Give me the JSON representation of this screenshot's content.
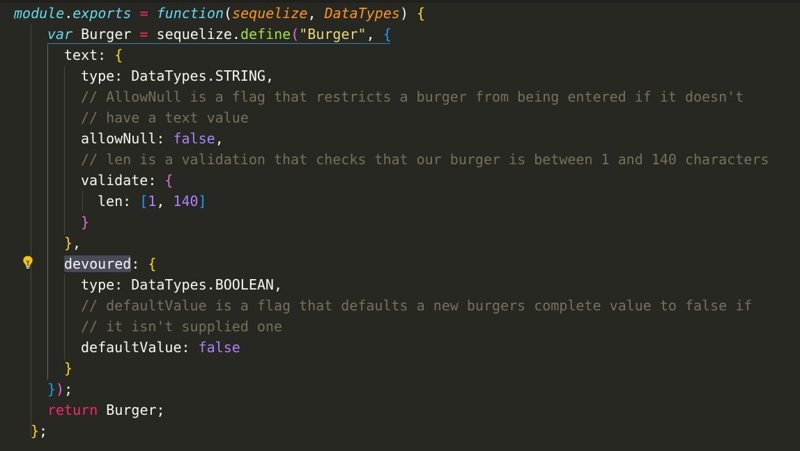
{
  "editor": {
    "theme_colors": {
      "background": "#272822",
      "keyword": "#f92672",
      "storage": "#66d9ef",
      "function_name": "#a6e22e",
      "string": "#e6db74",
      "constant": "#ae81ff",
      "comment": "#75715e",
      "parameter": "#fd971f"
    },
    "lightbulb_icon": "lightbulb-icon",
    "code": {
      "l1": {
        "module": "module",
        "dot": ".",
        "exports": "exports",
        "eq": " = ",
        "function": "function",
        "open_paren": "(",
        "p1": "sequelize",
        "comma": ", ",
        "p2": "DataTypes",
        "close_paren": ")",
        "space": " ",
        "brace": "{"
      },
      "l2": {
        "var": "var",
        "name": " Burger",
        "eq": " = ",
        "obj": "sequelize",
        "dot": ".",
        "method": "define",
        "open_paren": "(",
        "str": "\"Burger\"",
        "comma": ", ",
        "brace": "{"
      },
      "l3": {
        "key": "text",
        "colon": ": ",
        "brace": "{"
      },
      "l4": {
        "key": "type",
        "colon": ": ",
        "obj": "DataTypes",
        "dot": ".",
        "prop": "STRING",
        "comma": ","
      },
      "l5": {
        "comment": "// AllowNull is a flag that restricts a burger from being entered if it doesn't"
      },
      "l6": {
        "comment": "// have a text value"
      },
      "l7": {
        "key": "allowNull",
        "colon": ": ",
        "value": "false",
        "comma": ","
      },
      "l8": {
        "comment": "// len is a validation that checks that our burger is between 1 and 140 characters"
      },
      "l9": {
        "key": "validate",
        "colon": ": ",
        "brace": "{"
      },
      "l10": {
        "key": "len",
        "colon": ": ",
        "open_bracket": "[",
        "n1": "1",
        "comma": ", ",
        "n2": "140",
        "close_bracket": "]"
      },
      "l11": {
        "brace": "}"
      },
      "l12": {
        "brace": "}",
        "comma": ","
      },
      "l13": {
        "key": "devoured",
        "colon": ": ",
        "brace": "{"
      },
      "l14": {
        "key": "type",
        "colon": ": ",
        "obj": "DataTypes",
        "dot": ".",
        "prop": "BOOLEAN",
        "comma": ","
      },
      "l15": {
        "comment": "// defaultValue is a flag that defaults a new burgers complete value to false if"
      },
      "l16": {
        "comment": "// it isn't supplied one"
      },
      "l17": {
        "key": "defaultValue",
        "colon": ": ",
        "value": "false"
      },
      "l18": {
        "brace": "}"
      },
      "l19": {
        "brace": "}",
        "paren": ")",
        "semi": ";"
      },
      "l20": {
        "return": "return",
        "value": " Burger",
        "semi": ";"
      },
      "l21": {
        "brace": "}",
        "semi": ";"
      }
    }
  }
}
